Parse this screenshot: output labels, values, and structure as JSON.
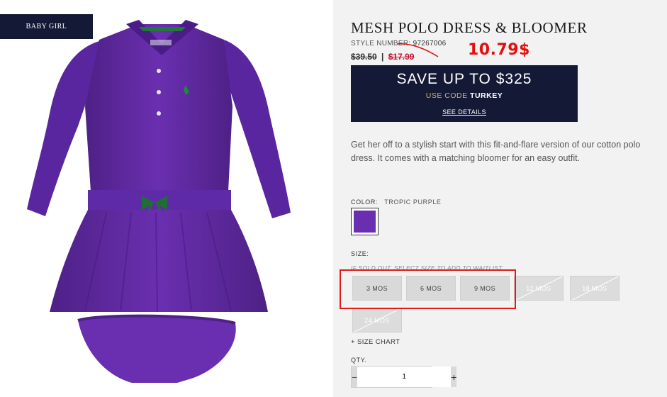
{
  "badge": "BABY GIRL",
  "product": {
    "title": "MESH POLO DRESS & BLOOMER",
    "style_label": "STYLE NUMBER:",
    "style_number": "97267006",
    "old_price": "$39.50",
    "separator": "|",
    "sale_price": "$17.99",
    "annotation_price": "10.79$",
    "description": "Get her off to a stylish start with this fit-and-flare version of our cotton polo dress. It comes with a matching bloomer for an easy outfit."
  },
  "promo": {
    "title": "SAVE UP TO $325",
    "code_prefix": "USE CODE",
    "code": "TURKEY",
    "link": "SEE DETAILS"
  },
  "color": {
    "label": "COLOR:",
    "value": "TROPIC PURPLE",
    "swatch_hex": "#6a2fb0"
  },
  "size": {
    "label": "SIZE:",
    "note": "IF SOLD OUT, SELECT SIZE TO ADD TO WAITLIST.",
    "options": [
      {
        "label": "3 MOS",
        "available": true
      },
      {
        "label": "6 MOS",
        "available": true
      },
      {
        "label": "9 MOS",
        "available": true
      },
      {
        "label": "12 MOS",
        "available": false
      },
      {
        "label": "18 MOS",
        "available": false
      },
      {
        "label": "24 MOS",
        "available": false
      }
    ],
    "chart_link": "+ SIZE CHART"
  },
  "qty": {
    "label": "QTY.",
    "minus": "−",
    "value": "1",
    "plus": "+"
  },
  "colors": {
    "navy": "#141a36",
    "accent_red": "#e01010",
    "dress_purple": "#6a2fb0"
  }
}
